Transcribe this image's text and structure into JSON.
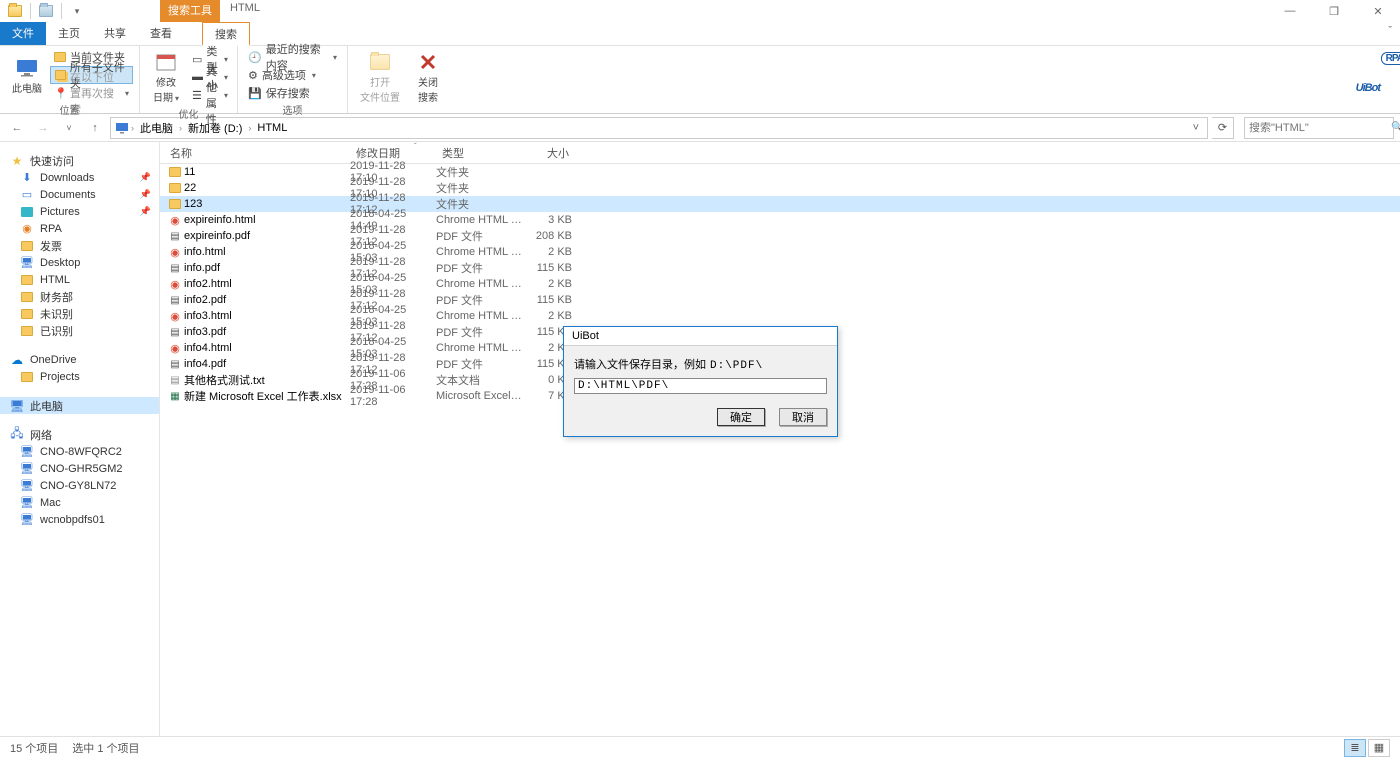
{
  "window": {
    "search_tools_category": "搜索工具",
    "context_tab": "HTML",
    "min": "—",
    "max": "❐",
    "close": "✕"
  },
  "tabs": {
    "file": "文件",
    "home": "主页",
    "share": "共享",
    "view": "查看",
    "search": "搜索",
    "collapse": "ˇ"
  },
  "ribbon": {
    "g1": {
      "this_pc": "此电脑",
      "current_folder": "当前文件夹",
      "all_subfolders": "所有子文件夹",
      "search_again": "在以下位置再次搜索",
      "label": "位置"
    },
    "g2": {
      "modify_date": "修改\n日期",
      "kind": "类型",
      "size": "大小",
      "other_props": "其他属性",
      "label": "优化"
    },
    "g3": {
      "recent": "最近的搜索内容",
      "advanced": "高级选项",
      "save_search": "保存搜索",
      "label": "选项"
    },
    "g4": {
      "open_location": "打开\n文件位置",
      "close_search": "关闭\n搜索"
    }
  },
  "logo": {
    "text": "UiBot",
    "badge": "RPA"
  },
  "addr": {
    "back": "←",
    "fwd": "→",
    "recent": "˅",
    "up": "↑",
    "crumbs": [
      "此电脑",
      "新加卷 (D:)",
      "HTML"
    ],
    "sep": "›",
    "dd": "˅",
    "refresh": "⟳",
    "search_placeholder": "搜索\"HTML\"",
    "search_icon": "🔍"
  },
  "nav": {
    "quick": {
      "label": "快速访问",
      "items": [
        {
          "label": "Downloads",
          "pin": true,
          "ico": "dl"
        },
        {
          "label": "Documents",
          "pin": true,
          "ico": "doc"
        },
        {
          "label": "Pictures",
          "pin": true,
          "ico": "pic"
        },
        {
          "label": "RPA",
          "ico": "rpa"
        },
        {
          "label": "发票",
          "ico": "folder"
        },
        {
          "label": "Desktop",
          "ico": "desk"
        },
        {
          "label": "HTML",
          "ico": "folder"
        },
        {
          "label": "财务部",
          "ico": "folder"
        },
        {
          "label": "未识别",
          "ico": "folder"
        },
        {
          "label": "已识别",
          "ico": "folder"
        }
      ]
    },
    "onedrive": {
      "label": "OneDrive",
      "items": [
        {
          "label": "Projects",
          "ico": "folder"
        }
      ]
    },
    "thispc": {
      "label": "此电脑"
    },
    "network": {
      "label": "网络",
      "items": [
        {
          "label": "CNO-8WFQRC2",
          "ico": "pc"
        },
        {
          "label": "CNO-GHR5GM2",
          "ico": "pc"
        },
        {
          "label": "CNO-GY8LN72",
          "ico": "pc"
        },
        {
          "label": "Mac",
          "ico": "pc"
        },
        {
          "label": "wcnobpdfs01",
          "ico": "pc"
        }
      ]
    }
  },
  "cols": {
    "name": "名称",
    "date": "修改日期",
    "type": "类型",
    "size": "大小"
  },
  "files": [
    {
      "ico": "folder",
      "name": "11",
      "date": "2019-11-28 17:10",
      "type": "文件夹",
      "size": ""
    },
    {
      "ico": "folder",
      "name": "22",
      "date": "2019-11-28 17:10",
      "type": "文件夹",
      "size": ""
    },
    {
      "ico": "folder",
      "name": "123",
      "date": "2019-11-28 17:12",
      "type": "文件夹",
      "size": "",
      "selected": true
    },
    {
      "ico": "html",
      "name": "expireinfo.html",
      "date": "2018-04-25 14:49",
      "type": "Chrome HTML D...",
      "size": "3 KB"
    },
    {
      "ico": "pdf",
      "name": "expireinfo.pdf",
      "date": "2019-11-28 17:12",
      "type": "PDF 文件",
      "size": "208 KB"
    },
    {
      "ico": "html",
      "name": "info.html",
      "date": "2018-04-25 15:03",
      "type": "Chrome HTML D...",
      "size": "2 KB"
    },
    {
      "ico": "pdf",
      "name": "info.pdf",
      "date": "2019-11-28 17:12",
      "type": "PDF 文件",
      "size": "115 KB"
    },
    {
      "ico": "html",
      "name": "info2.html",
      "date": "2018-04-25 15:03",
      "type": "Chrome HTML D...",
      "size": "2 KB"
    },
    {
      "ico": "pdf",
      "name": "info2.pdf",
      "date": "2019-11-28 17:12",
      "type": "PDF 文件",
      "size": "115 KB"
    },
    {
      "ico": "html",
      "name": "info3.html",
      "date": "2018-04-25 15:03",
      "type": "Chrome HTML D...",
      "size": "2 KB"
    },
    {
      "ico": "pdf",
      "name": "info3.pdf",
      "date": "2019-11-28 17:12",
      "type": "PDF 文件",
      "size": "115 KB"
    },
    {
      "ico": "html",
      "name": "info4.html",
      "date": "2018-04-25 15:03",
      "type": "Chrome HTML D...",
      "size": "2 KB"
    },
    {
      "ico": "pdf",
      "name": "info4.pdf",
      "date": "2019-11-28 17:12",
      "type": "PDF 文件",
      "size": "115 KB"
    },
    {
      "ico": "txt",
      "name": "其他格式测试.txt",
      "date": "2019-11-06 17:28",
      "type": "文本文档",
      "size": "0 KB"
    },
    {
      "ico": "xlsx",
      "name": "新建 Microsoft Excel 工作表.xlsx",
      "date": "2019-11-06 17:28",
      "type": "Microsoft Excel ...",
      "size": "7 KB"
    }
  ],
  "status": {
    "count": "15 个项目",
    "selected": "选中 1 个项目"
  },
  "dialog": {
    "title": "UiBot",
    "prompt": "请输入文件保存目录，例如",
    "example": "D:\\PDF\\",
    "value": "D:\\HTML\\PDF\\",
    "ok": "确定",
    "cancel": "取消"
  }
}
